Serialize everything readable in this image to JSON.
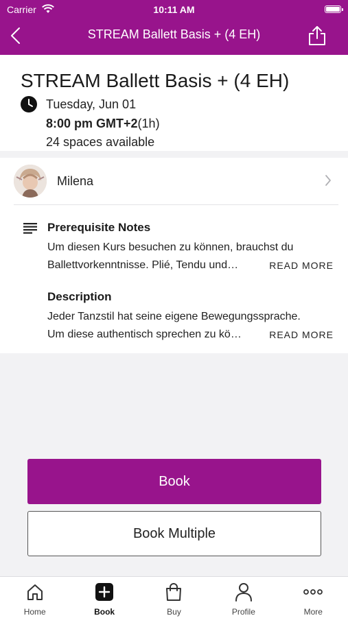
{
  "status_bar": {
    "carrier": "Carrier",
    "time": "10:11 AM"
  },
  "nav": {
    "title": "STREAM Ballett Basis + (4 EH)",
    "back_icon": "chevron-left-icon",
    "share_icon": "share-icon"
  },
  "class": {
    "title": "STREAM Ballett Basis + (4 EH)",
    "date": "Tuesday, Jun 01",
    "time": "8:00 pm GMT+2",
    "duration": "(1h)",
    "spaces": "24 spaces available"
  },
  "teacher": {
    "name": "Milena"
  },
  "prerequisite": {
    "label": "Prerequisite Notes",
    "line1": "Um diesen Kurs besuchen zu können, brauchst du",
    "line2": "Ballettvorkenntnisse. Plié, Tendu und…",
    "read_more": "READ MORE"
  },
  "description": {
    "label": "Description",
    "line1": "Jeder Tanzstil hat seine eigene Bewegungssprache.",
    "line2": "Um diese authentisch sprechen zu kö…",
    "read_more": "READ MORE"
  },
  "actions": {
    "book": "Book",
    "book_multiple": "Book Multiple"
  },
  "tabs": [
    {
      "label": "Home",
      "icon": "home-icon"
    },
    {
      "label": "Book",
      "icon": "book-plus-icon",
      "active": true
    },
    {
      "label": "Buy",
      "icon": "shopping-bag-icon"
    },
    {
      "label": "Profile",
      "icon": "profile-icon"
    },
    {
      "label": "More",
      "icon": "more-icon"
    }
  ],
  "colors": {
    "brand": "#98148c",
    "background": "#f2f2f4"
  }
}
